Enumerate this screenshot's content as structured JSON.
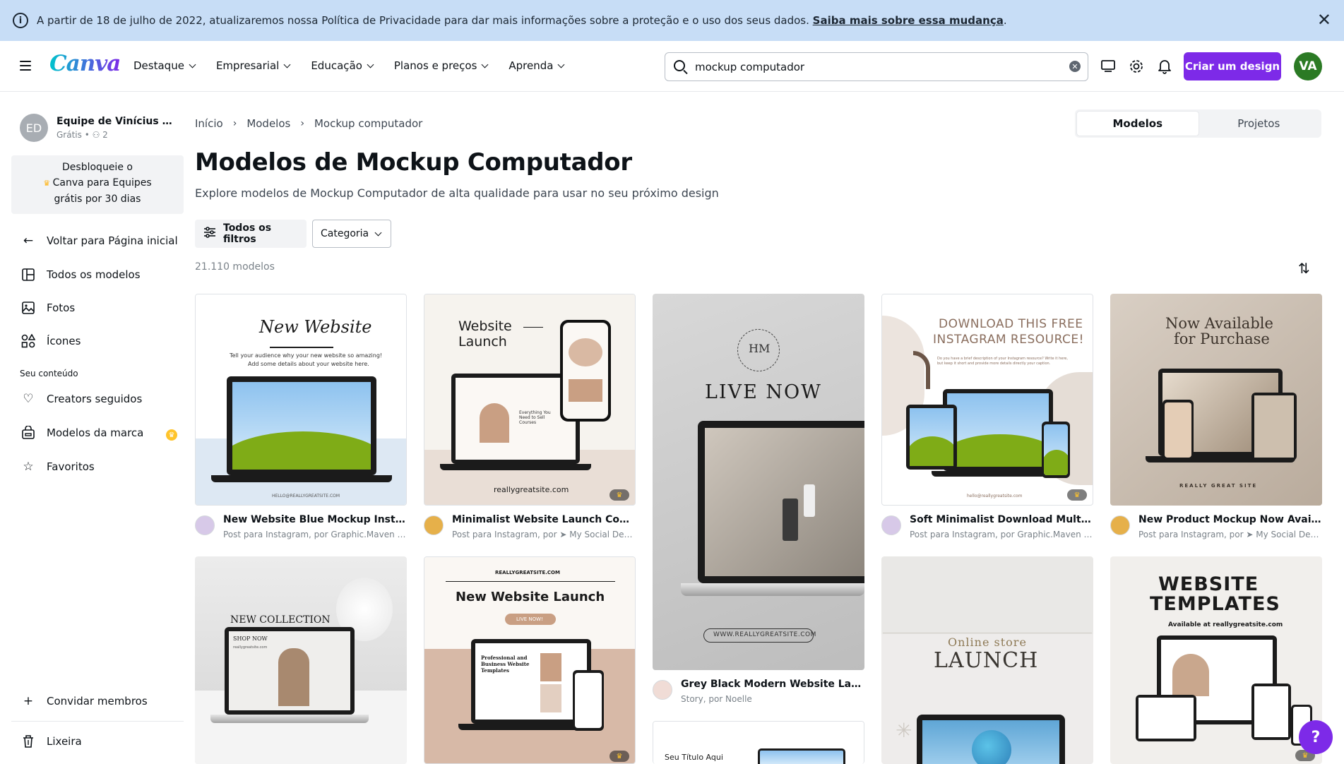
{
  "banner": {
    "text": "A partir de 18 de julho de 2022, atualizaremos nossa Política de Privacidade para dar mais informações sobre a proteção e o uso dos seus dados. ",
    "link": "Saiba mais sobre essa mudança",
    "tail": "."
  },
  "nav": {
    "logo": "Canva",
    "menu": [
      "Destaque",
      "Empresarial",
      "Educação",
      "Planos e preços",
      "Aprenda"
    ],
    "search_value": "mockup computador",
    "create_button": "Criar um design",
    "avatar": "VA"
  },
  "sidebar": {
    "team_initials": "ED",
    "team_name": "Equipe de Vinícius And...",
    "team_plan": "Grátis • ",
    "team_members": "2",
    "promo_line1": "Desbloqueie o",
    "promo_line2": "Canva para Equipes",
    "promo_line3": "grátis por 30 dias",
    "back": "Voltar para Página inicial",
    "items": [
      "Todos os modelos",
      "Fotos",
      "Ícones"
    ],
    "section": "Seu conteúdo",
    "content_items": [
      "Creators seguidos",
      "Modelos da marca",
      "Favoritos"
    ],
    "invite": "Convidar membros",
    "trash": "Lixeira"
  },
  "breadcrumb": [
    "Início",
    "Modelos",
    "Mockup computador"
  ],
  "toggle": {
    "models": "Modelos",
    "projects": "Projetos"
  },
  "title": "Modelos de Mockup Computador",
  "subtitle": "Explore modelos de Mockup Computador de alta qualidade para usar no seu próximo design",
  "filters": {
    "all": "Todos os filtros",
    "category": "Categoria"
  },
  "count": "21.110 modelos",
  "cards": [
    {
      "title": "New Website Blue Mockup Instagra...",
      "sub": "Post para Instagram, por Graphic.Maven by...",
      "t1": "New Website",
      "t2": "Tell your audience why your new website so amazing!",
      "t3": "Add some details about your website here.",
      "t4": "HELLO@REALLYGREATSITE.COM"
    },
    {
      "title": "Minimalist Website Launch Comput...",
      "sub": "Post para Instagram, por ➤ My Social Desig...",
      "t1": "Website",
      "t2": "Launch",
      "t3": "reallygreatsite.com",
      "t4": "Everything You Need to Sell Courses"
    },
    {
      "title": "Grey Black Modern Website Laptop ...",
      "sub": "Story, por Noelle",
      "t1": "REALLYGREATSITE",
      "t2": "HM",
      "t3": "LIVE NOW",
      "t4": "WWW.REALLYGREATSITE.COM"
    },
    {
      "title": "Soft Minimalist Download Multiple ...",
      "sub": "Post para Instagram, por Graphic.Maven by...",
      "t1": "DOWNLOAD THIS FREE",
      "t2": "INSTAGRAM RESOURCE!",
      "t3": "Do you have a brief description of your Instagram resource? Write it here, but keep it short and provide more details directly your caption.",
      "t4": "hello@reallygreatsite.com"
    },
    {
      "title": "New Product Mockup Now Available ...",
      "sub": "Post para Instagram, por ➤ My Social Desig...",
      "t1": "Now Available",
      "t2": "for Purchase",
      "t3": "REALLY GREAT SITE"
    },
    {
      "t1": "NEW COLLECTION",
      "t2": "SHOP NOW",
      "t3": "reallygreatsite.com"
    },
    {
      "t1": "REALLYGREATSITE.COM",
      "t2": "New Website Launch",
      "t3": "LIVE NOW!",
      "t4": "Professional and Business Website Templates"
    },
    {
      "t1": "Seu Título Aqui"
    },
    {
      "t1": "Online store",
      "t2": "LAUNCH"
    },
    {
      "t1": "WEBSITE",
      "t2": "TEMPLATES",
      "t3": "Available at reallygreatsite.com"
    }
  ],
  "help": "?"
}
